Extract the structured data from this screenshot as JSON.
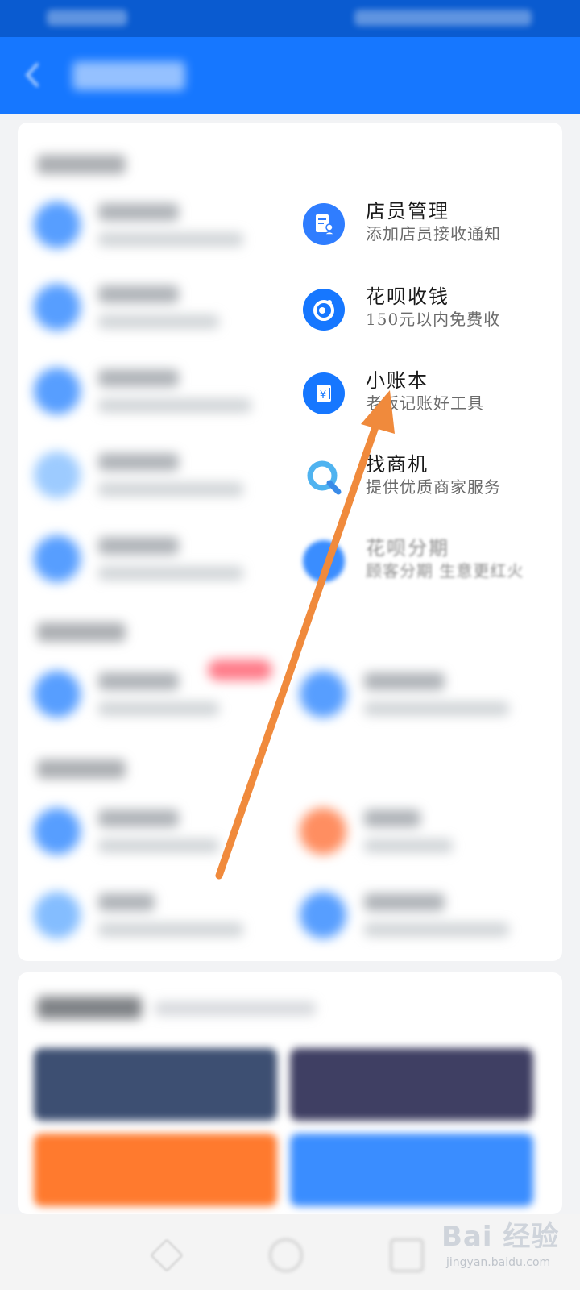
{
  "services": [
    {
      "title": "店员管理",
      "subtitle": "添加店员接收通知",
      "icon": "staff-management-icon"
    },
    {
      "title": "花呗收钱",
      "subtitle": "150元以内免费收",
      "icon": "huabei-collect-icon"
    },
    {
      "title": "小账本",
      "subtitle": "老板记账好工具",
      "icon": "ledger-icon"
    },
    {
      "title": "找商机",
      "subtitle": "提供优质商家服务",
      "icon": "find-business-icon"
    },
    {
      "title": "花呗分期",
      "subtitle": "顾客分期 生意更红火",
      "icon": "huabei-installment-icon"
    }
  ],
  "watermark": {
    "logo": "Bai 经验",
    "url": "jingyan.baidu.com"
  },
  "colors": {
    "accent": "#1677ff",
    "header": "#1677ff",
    "arrow": "#f08a3c"
  }
}
